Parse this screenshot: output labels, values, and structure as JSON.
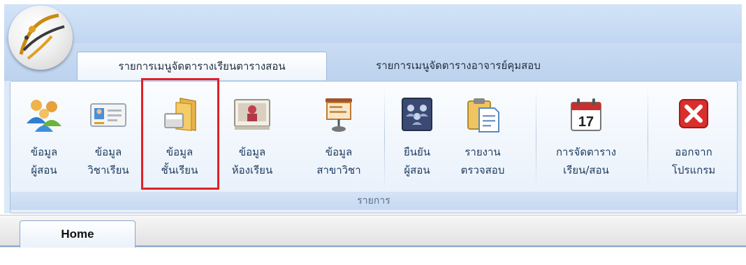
{
  "tabs": [
    {
      "label": "รายการเมนูจัดตารางเรียนตารางสอน",
      "active": true
    },
    {
      "label": "รายการเมนูจัดตารางอาจารย์คุมสอบ",
      "active": false
    }
  ],
  "ribbon": {
    "group_label": "รายการ",
    "buttons": [
      {
        "line1": "ข้อมูล",
        "line2": "ผู้สอน",
        "icon": "teachers-icon"
      },
      {
        "line1": "ข้อมูล",
        "line2": "วิชาเรียน",
        "icon": "id-card-icon"
      },
      {
        "line1": "ข้อมูล",
        "line2": "ชั้นเรียน",
        "icon": "folder-icon"
      },
      {
        "line1": "ข้อมูล",
        "line2": "ห้องเรียน",
        "icon": "classroom-icon"
      },
      {
        "line1": "ข้อมูล",
        "line2": "สาขาวิชา",
        "icon": "presentation-board-icon"
      },
      {
        "line1": "ยืนยัน",
        "line2": "ผู้สอน",
        "icon": "address-book-icon"
      },
      {
        "line1": "รายงาน",
        "line2": "ตรวจสอบ",
        "icon": "clipboard-icon"
      },
      {
        "line1": "การจัดตาราง",
        "line2": "เรียน/สอน",
        "icon": "calendar-icon"
      },
      {
        "line1": "ออกจาก",
        "line2": "โปรแกรม",
        "icon": "close-icon"
      }
    ]
  },
  "calendar_day": "17",
  "document_tab": {
    "label": "Home"
  },
  "colors": {
    "highlight": "#e0202a",
    "ribbon_bg": "#dce9f8",
    "exit_red": "#d8302c"
  }
}
